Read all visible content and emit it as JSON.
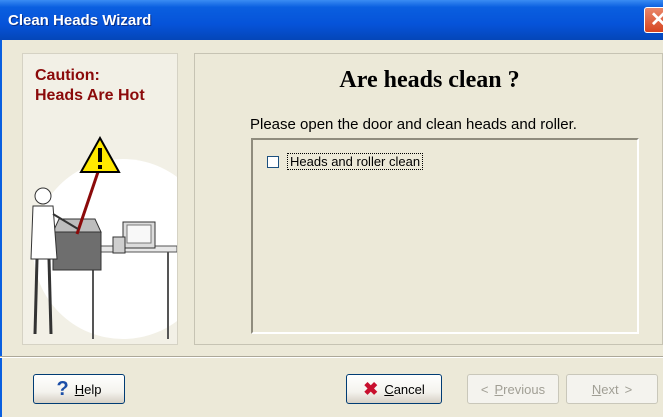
{
  "window": {
    "title": "Clean Heads Wizard"
  },
  "left_panel": {
    "caution_line1": "Caution:",
    "caution_line2": "Heads Are Hot"
  },
  "main": {
    "heading": "Are heads clean ?",
    "instruction": "Please open the door and clean heads and roller.",
    "checkbox": {
      "label": "Heads and roller clean",
      "checked": false
    }
  },
  "buttons": {
    "help": {
      "mnemonic": "H",
      "rest": "elp"
    },
    "cancel": {
      "mnemonic": "C",
      "rest": "ancel"
    },
    "previous": {
      "mnemonic": "P",
      "rest": "revious"
    },
    "next": {
      "mnemonic": "N",
      "rest": "ext"
    }
  },
  "icons": {
    "close": "close-icon",
    "help": "question-icon",
    "cancel": "x-icon",
    "previous": "arrow-left-icon",
    "next": "arrow-right-icon",
    "warning": "warning-icon"
  }
}
